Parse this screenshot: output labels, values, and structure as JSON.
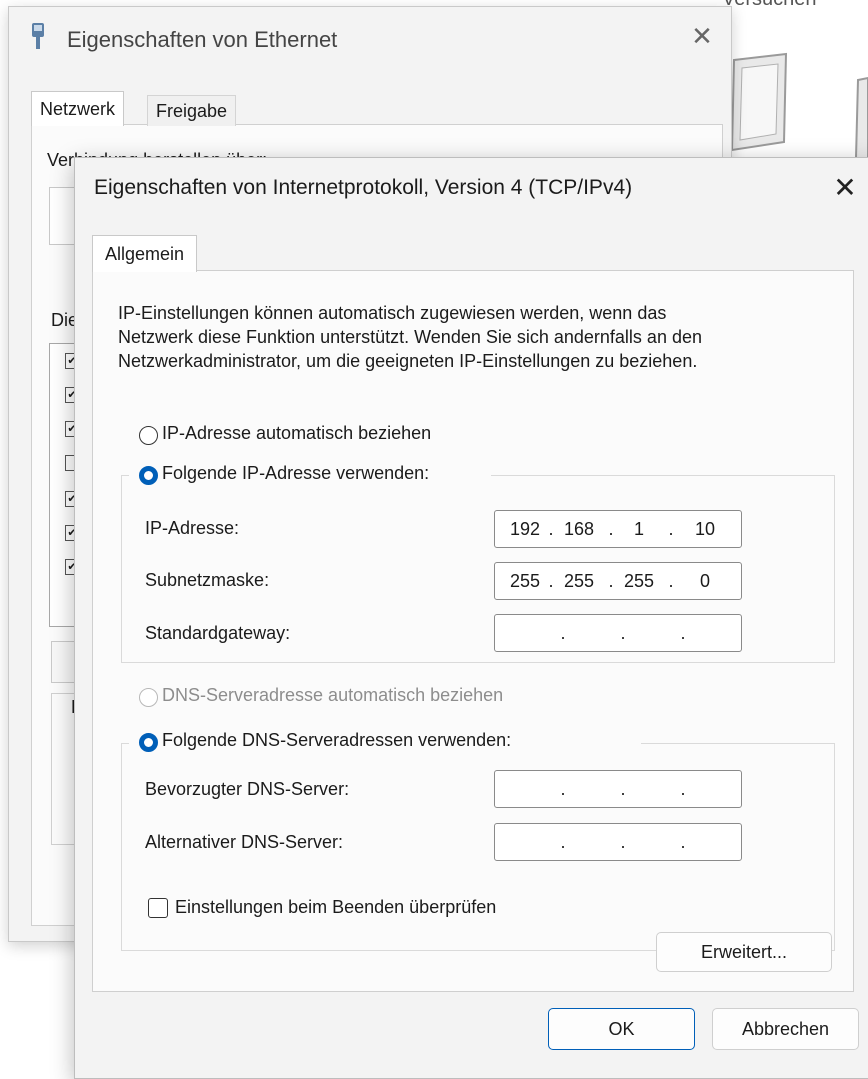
{
  "bg_window": {
    "title": "Eigenschaften von Ethernet",
    "close_glyph": "✕",
    "tabs": [
      "Netzwerk",
      "Freigabe"
    ],
    "connect_label": "Verbindung herstellen über:",
    "dies_label": "Die",
    "group_letter": "E"
  },
  "far_window": {
    "title_fragment": "Versuchen"
  },
  "dialog": {
    "title": "Eigenschaften von Internetprotokoll, Version 4 (TCP/IPv4)",
    "close_glyph": "✕",
    "tab": "Allgemein",
    "info_lines": [
      "IP-Einstellungen können automatisch zugewiesen werden, wenn das",
      "Netzwerk diese Funktion unterstützt. Wenden Sie sich andernfalls an den",
      "Netzwerkadministrator, um die geeigneten IP-Einstellungen zu beziehen."
    ],
    "ip_auto_label": "IP-Adresse automatisch beziehen",
    "ip_manual_label": "Folgende IP-Adresse verwenden:",
    "ip_fields": [
      {
        "label": "IP-Adresse:",
        "octets": [
          "192",
          "168",
          "1",
          "10"
        ]
      },
      {
        "label": "Subnetzmaske:",
        "octets": [
          "255",
          "255",
          "255",
          "0"
        ]
      },
      {
        "label": "Standardgateway:",
        "octets": [
          "",
          "",
          "",
          ""
        ]
      }
    ],
    "dns_auto_label": "DNS-Serveradresse automatisch beziehen",
    "dns_manual_label": "Folgende DNS-Serveradressen verwenden:",
    "dns_fields": [
      {
        "label": "Bevorzugter DNS-Server:",
        "octets": [
          "",
          "",
          "",
          ""
        ]
      },
      {
        "label": "Alternativer DNS-Server:",
        "octets": [
          "",
          "",
          "",
          ""
        ]
      }
    ],
    "validate_label": "Einstellungen beim Beenden überprüfen",
    "advanced_button": "Erweitert...",
    "ok_button": "OK",
    "cancel_button": "Abbrechen",
    "ip_mode": "manual",
    "dns_mode": "manual",
    "validate_checked": false
  },
  "colors": {
    "accent": "#005fb8",
    "dialog_bg": "#f3f3f3",
    "panel_bg": "#fbfbfb"
  }
}
